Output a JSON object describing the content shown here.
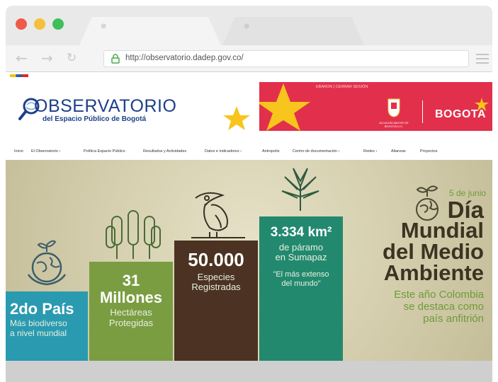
{
  "browser": {
    "url": "http://observatorio.dadep.gov.co/",
    "tab_close_glyph": "⊗",
    "colors": {
      "close": "#ef5a4a",
      "minimize": "#f5bf3a",
      "maximize": "#3fbf5a"
    }
  },
  "header": {
    "logo_title": "OBSERVATORIO",
    "logo_subtitle": "del Espacio Público de Bogotá",
    "session_links": "EBARON | CERRAR SESIÓN",
    "alcaldia_label": "ALCALDÍA MAYOR DE BOGOTÁ D.C.",
    "bogota_brand": "BOGOTA",
    "accent_color": "#e2304c"
  },
  "nav": {
    "items": [
      "Inicio",
      "El Observatorio",
      "Política Espacio Público",
      "Resultados y Actividades",
      "Datos e indicadores",
      "Antropolis",
      "Centro de documentación",
      "Redes",
      "Alianzas",
      "Proyectos"
    ],
    "dropdown_glyph": "›"
  },
  "hero": {
    "stats": [
      {
        "big": "2do País",
        "small1": "Más biodiverso",
        "small2": "a nivel mundial",
        "color": "#2a9ab1"
      },
      {
        "big": "31",
        "big2": "Millones",
        "small1": "Hectáreas",
        "small2": "Protegidas",
        "color": "#7a9d42"
      },
      {
        "big": "50.000",
        "small1": "Especies",
        "small2": "Registradas",
        "color": "#4b3222"
      },
      {
        "big": "3.334 km²",
        "small1": "de páramo",
        "small2": "en Sumapaz",
        "quote1": "\"El más extenso",
        "quote2": "del mundo\"",
        "color": "#22896f"
      }
    ],
    "date": "5 de junio",
    "headline": [
      "Día",
      "Mundial",
      "del Medio",
      "Ambiente"
    ],
    "sub": [
      "Este año Colombia",
      "se destaca como",
      "país anfitrión"
    ],
    "headline_color": "#3d3322",
    "sub_color": "#6e9b3a"
  }
}
